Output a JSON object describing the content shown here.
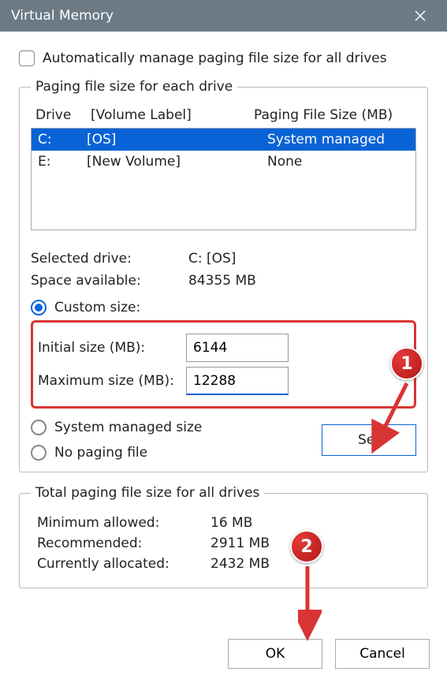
{
  "title": "Virtual Memory",
  "auto_label": "Automatically manage paging file size for all drives",
  "group1_legend": "Paging file size for each drive",
  "headers": {
    "drive": "Drive",
    "volume": "[Volume Label]",
    "size": "Paging File Size (MB)"
  },
  "drives": [
    {
      "letter": "C:",
      "volume": "[OS]",
      "size": "System managed",
      "selected": true
    },
    {
      "letter": "E:",
      "volume": "[New Volume]",
      "size": "None",
      "selected": false
    }
  ],
  "selected_drive_label": "Selected drive:",
  "selected_drive_value": "C:  [OS]",
  "space_label": "Space available:",
  "space_value": "84355 MB",
  "custom_size_label": "Custom size:",
  "initial_label": "Initial size (MB):",
  "initial_value": "6144",
  "max_label": "Maximum size (MB):",
  "max_value": "12288",
  "system_managed_label": "System managed size",
  "no_paging_label": "No paging file",
  "set_label": "Set",
  "group2_legend": "Total paging file size for all drives",
  "min_label": "Minimum allowed:",
  "min_value": "16 MB",
  "rec_label": "Recommended:",
  "rec_value": "2911 MB",
  "cur_label": "Currently allocated:",
  "cur_value": "2432 MB",
  "ok_label": "OK",
  "cancel_label": "Cancel",
  "markers": {
    "m1": "1",
    "m2": "2"
  }
}
